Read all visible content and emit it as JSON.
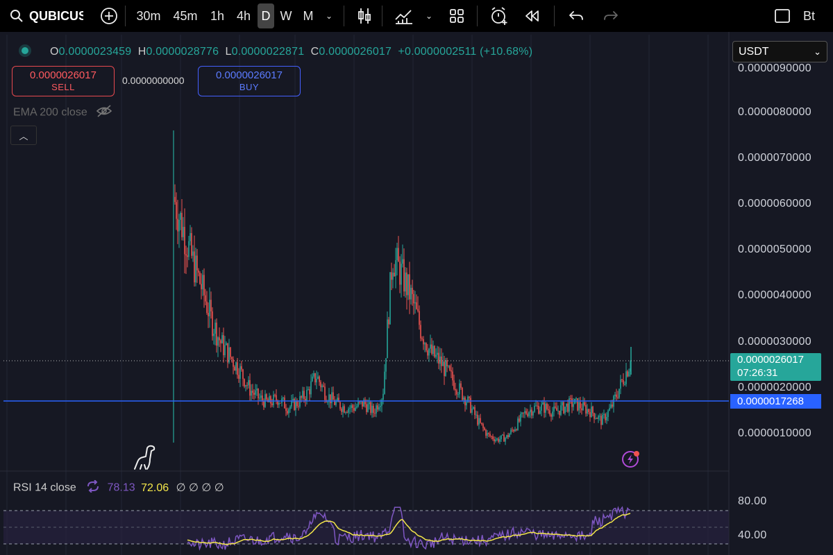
{
  "toolbar": {
    "symbol": "QUBICUS",
    "timeframes": [
      "30m",
      "45m",
      "1h",
      "4h",
      "D",
      "W",
      "M"
    ],
    "active_timeframe": "D",
    "right_text": "Bt"
  },
  "legend": {
    "o_label": "O",
    "o": "0.0000023459",
    "h_label": "H",
    "h": "0.0000028776",
    "l_label": "L",
    "l": "0.0000022871",
    "c_label": "C",
    "c": "0.0000026017",
    "change": "+0.0000002511 (+10.68%)"
  },
  "trade": {
    "sell_price": "0.0000026017",
    "sell_label": "SELL",
    "spread": "0.0000000000",
    "buy_price": "0.0000026017",
    "buy_label": "BUY"
  },
  "indicator": {
    "ema": "EMA 200 close"
  },
  "currency": {
    "value": "USDT"
  },
  "price_axis": {
    "labels": [
      "0.0000090000",
      "0.0000080000",
      "0.0000070000",
      "0.0000060000",
      "0.0000050000",
      "0.0000040000",
      "0.0000030000",
      "0.0000020000",
      "0.0000010000"
    ]
  },
  "last_price": {
    "price": "0.0000026017",
    "countdown": "07:26:31"
  },
  "horizontal_line": {
    "price": "0.0000017268"
  },
  "rsi": {
    "label": "RSI 14 close",
    "value1": "78.13",
    "value2": "72.06",
    "placeholders": "∅ ∅ ∅ ∅",
    "axis": [
      "80.00",
      "40.00"
    ]
  },
  "colors": {
    "up": "#26a69a",
    "down": "#ef5350",
    "hline": "#2962ff",
    "rsi_line": "#7e57c2",
    "rsi_ma": "#f5e84a"
  },
  "chart_data": {
    "type": "candlestick",
    "price_series_approx": [
      6.2,
      5.5,
      4.8,
      4.2,
      3.5,
      3.0,
      2.7,
      2.4,
      2.0,
      1.8,
      1.7,
      1.8,
      1.6,
      1.7,
      1.9,
      2.3,
      1.9,
      1.7,
      1.6,
      1.6,
      1.7,
      1.5,
      1.9,
      4.9,
      4.5,
      4.0,
      3.3,
      2.8,
      2.6,
      2.3,
      2.0,
      1.7,
      1.3,
      1.0,
      0.9,
      0.95,
      1.2,
      1.5,
      1.6,
      1.6,
      1.5,
      1.6,
      1.7,
      1.6,
      1.5,
      1.3,
      1.6,
      2.1,
      2.6
    ],
    "ylim": [
      2e-07,
      9.5e-06
    ],
    "rsi_ylim": [
      20,
      100
    ]
  }
}
